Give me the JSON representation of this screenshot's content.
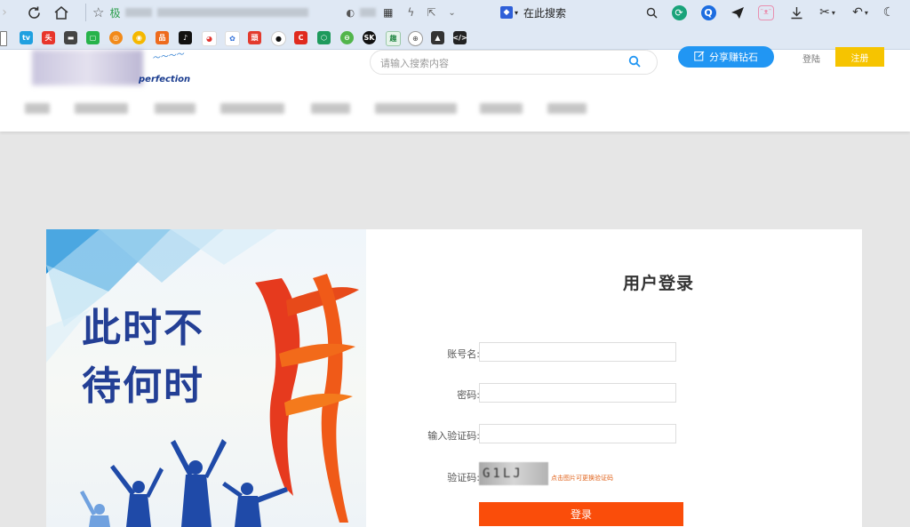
{
  "browser": {
    "address_partial": "极",
    "search_engine_label": "在此搜索"
  },
  "site": {
    "logo_tag": "perfection",
    "search_placeholder": "请输入搜索内容",
    "share_button_label": "分享赚钻石",
    "login_link": "登陆",
    "register_label": "注册"
  },
  "banner": {
    "line1": "此时不",
    "line2": "待何时",
    "brush_char": "拼"
  },
  "login": {
    "title": "用户登录",
    "account_label": "账号名:",
    "password_label": "密码:",
    "captcha_input_label": "输入验证码:",
    "captcha_label": "验证码:",
    "captcha_text": "G1LJ",
    "captcha_hint": "点击图片可更换验证码",
    "submit_label": "登录"
  },
  "colors": {
    "accent_blue": "#2196f3",
    "register_yellow": "#f6c400",
    "login_orange": "#fa4d0a",
    "banner_title_blue": "#233f95"
  }
}
